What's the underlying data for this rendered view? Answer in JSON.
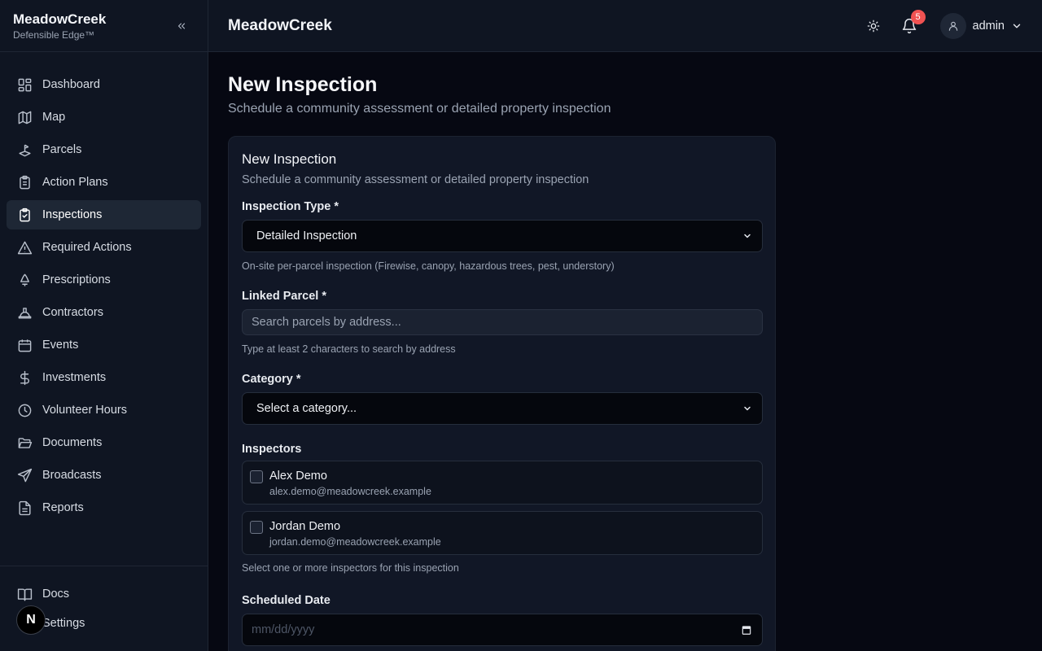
{
  "sidebar": {
    "brand_name": "MeadowCreek",
    "brand_tagline": "Defensible Edge™",
    "items": [
      {
        "label": "Dashboard",
        "icon": "dashboard-icon"
      },
      {
        "label": "Map",
        "icon": "map-icon"
      },
      {
        "label": "Parcels",
        "icon": "parcels-icon"
      },
      {
        "label": "Action Plans",
        "icon": "clipboard-list-icon"
      },
      {
        "label": "Inspections",
        "icon": "clipboard-check-icon",
        "active": true
      },
      {
        "label": "Required Actions",
        "icon": "warning-triangle-icon"
      },
      {
        "label": "Prescriptions",
        "icon": "tree-icon"
      },
      {
        "label": "Contractors",
        "icon": "hard-hat-icon"
      },
      {
        "label": "Events",
        "icon": "calendar-icon"
      },
      {
        "label": "Investments",
        "icon": "dollar-icon"
      },
      {
        "label": "Volunteer Hours",
        "icon": "clock-icon"
      },
      {
        "label": "Documents",
        "icon": "folder-icon"
      },
      {
        "label": "Broadcasts",
        "icon": "send-icon"
      },
      {
        "label": "Reports",
        "icon": "file-text-icon"
      }
    ],
    "bottom_items": [
      {
        "label": "Docs",
        "icon": "book-icon"
      },
      {
        "label": "Settings",
        "icon": "gear-icon"
      }
    ],
    "next_badge": "N"
  },
  "header": {
    "title": "MeadowCreek",
    "notification_count": "5",
    "user_name": "admin"
  },
  "page": {
    "title": "New Inspection",
    "subtitle": "Schedule a community assessment or detailed property inspection"
  },
  "form": {
    "card_title": "New Inspection",
    "card_subtitle": "Schedule a community assessment or detailed property inspection",
    "inspection_type": {
      "label": "Inspection Type *",
      "value": "Detailed Inspection",
      "hint": "On-site per-parcel inspection (Firewise, canopy, hazardous trees, pest, understory)"
    },
    "linked_parcel": {
      "label": "Linked Parcel *",
      "placeholder": "Search parcels by address...",
      "hint": "Type at least 2 characters to search by address"
    },
    "category": {
      "label": "Category *",
      "value": "Select a category..."
    },
    "inspectors": {
      "label": "Inspectors",
      "list": [
        {
          "name": "Alex Demo",
          "email": "alex.demo@meadowcreek.example"
        },
        {
          "name": "Jordan Demo",
          "email": "jordan.demo@meadowcreek.example"
        }
      ],
      "hint": "Select one or more inspectors for this inspection"
    },
    "scheduled_date": {
      "label": "Scheduled Date",
      "placeholder": "mm/dd/yyyy"
    }
  },
  "colors": {
    "background": "#060812",
    "sidebar": "#0f1522",
    "active_item": "#1e2735",
    "badge": "#f05252"
  }
}
